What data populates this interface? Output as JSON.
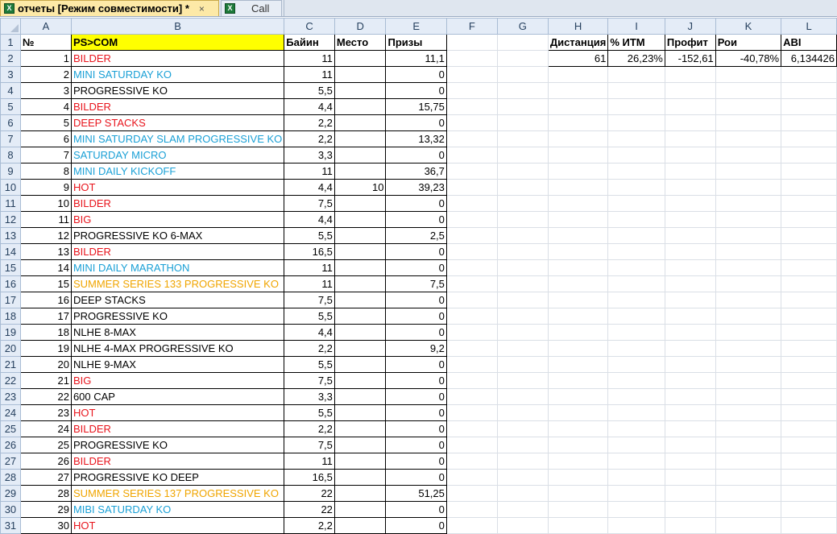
{
  "tabs": [
    {
      "title": "отчеты  [Режим совместимости] *",
      "close": "×",
      "active": true
    },
    {
      "title": "Call",
      "active": false
    }
  ],
  "columns": [
    "A",
    "B",
    "C",
    "D",
    "E",
    "F",
    "G",
    "H",
    "I",
    "J",
    "K",
    "L"
  ],
  "headers": {
    "A": "№",
    "B": "PS>COM",
    "C": "Байин",
    "D": "Место",
    "E": "Призы"
  },
  "stats": {
    "labels": [
      "Дистанция",
      "% ИТМ",
      "Профит",
      "Рои",
      "ABI"
    ],
    "values": [
      "61",
      "26,23%",
      "-152,61",
      "-40,78%",
      "6,134426"
    ]
  },
  "colors": {
    "red": "#e8141c",
    "blue": "#1aa0d6",
    "orange": "#f0a500",
    "black": "#000000",
    "highlight": "#ffff00"
  },
  "rows": [
    {
      "n": "1",
      "name": "BILDER",
      "color": "red",
      "buyin": "11",
      "place": "",
      "prize": "11,1"
    },
    {
      "n": "2",
      "name": "MINI SATURDAY KO",
      "color": "blue",
      "buyin": "11",
      "place": "",
      "prize": "0"
    },
    {
      "n": "3",
      "name": "PROGRESSIVE KO",
      "color": "black",
      "buyin": "5,5",
      "place": "",
      "prize": "0"
    },
    {
      "n": "4",
      "name": "BILDER",
      "color": "red",
      "buyin": "4,4",
      "place": "",
      "prize": "15,75"
    },
    {
      "n": "5",
      "name": "DEEP STACKS",
      "color": "red",
      "buyin": "2,2",
      "place": "",
      "prize": "0"
    },
    {
      "n": "6",
      "name": "MINI SATURDAY SLAM PROGRESSIVE  KO",
      "color": "blue",
      "buyin": "2,2",
      "place": "",
      "prize": "13,32"
    },
    {
      "n": "7",
      "name": "SATURDAY MICRO",
      "color": "blue",
      "buyin": "3,3",
      "place": "",
      "prize": "0"
    },
    {
      "n": "8",
      "name": "MINI DAILY KICKOFF",
      "color": "blue",
      "buyin": "11",
      "place": "",
      "prize": "36,7"
    },
    {
      "n": "9",
      "name": "HOT",
      "color": "red",
      "buyin": "4,4",
      "place": "10",
      "prize": "39,23"
    },
    {
      "n": "10",
      "name": "BILDER",
      "color": "red",
      "buyin": "7,5",
      "place": "",
      "prize": "0"
    },
    {
      "n": "11",
      "name": "BIG",
      "color": "red",
      "buyin": "4,4",
      "place": "",
      "prize": "0"
    },
    {
      "n": "12",
      "name": "PROGRESSIVE KO 6-MAX",
      "color": "black",
      "buyin": "5,5",
      "place": "",
      "prize": "2,5"
    },
    {
      "n": "13",
      "name": "BILDER",
      "color": "red",
      "buyin": "16,5",
      "place": "",
      "prize": "0"
    },
    {
      "n": "14",
      "name": "MINI DAILY MARATHON",
      "color": "blue",
      "buyin": "11",
      "place": "",
      "prize": "0"
    },
    {
      "n": "15",
      "name": "SUMMER SERIES 133 PROGRESSIVE KO",
      "color": "orange",
      "buyin": "11",
      "place": "",
      "prize": "7,5"
    },
    {
      "n": "16",
      "name": "DEEP STACKS",
      "color": "black",
      "buyin": "7,5",
      "place": "",
      "prize": "0"
    },
    {
      "n": "17",
      "name": "PROGRESSIVE KO",
      "color": "black",
      "buyin": "5,5",
      "place": "",
      "prize": "0"
    },
    {
      "n": "18",
      "name": "NLHE 8-MAX",
      "color": "black",
      "buyin": "4,4",
      "place": "",
      "prize": "0"
    },
    {
      "n": "19",
      "name": "NLHE 4-MAX PROGRESSIVE KO",
      "color": "black",
      "buyin": "2,2",
      "place": "",
      "prize": "9,2"
    },
    {
      "n": "20",
      "name": "NLHE 9-MAX",
      "color": "black",
      "buyin": "5,5",
      "place": "",
      "prize": "0"
    },
    {
      "n": "21",
      "name": "BIG",
      "color": "red",
      "buyin": "7,5",
      "place": "",
      "prize": "0"
    },
    {
      "n": "22",
      "name": "600 CAP",
      "color": "black",
      "buyin": "3,3",
      "place": "",
      "prize": "0"
    },
    {
      "n": "23",
      "name": "HOT",
      "color": "red",
      "buyin": "5,5",
      "place": "",
      "prize": "0"
    },
    {
      "n": "24",
      "name": "BILDER",
      "color": "red",
      "buyin": "2,2",
      "place": "",
      "prize": "0"
    },
    {
      "n": "25",
      "name": "PROGRESSIVE KO",
      "color": "black",
      "buyin": "7,5",
      "place": "",
      "prize": "0"
    },
    {
      "n": "26",
      "name": "BILDER",
      "color": "red",
      "buyin": "11",
      "place": "",
      "prize": "0"
    },
    {
      "n": "27",
      "name": "PROGRESSIVE KO DEEP",
      "color": "black",
      "buyin": "16,5",
      "place": "",
      "prize": "0"
    },
    {
      "n": "28",
      "name": "SUMMER SERIES 137 PROGRESSIVE KO",
      "color": "orange",
      "buyin": "22",
      "place": "",
      "prize": "51,25"
    },
    {
      "n": "29",
      "name": "MIBI SATURDAY KO",
      "color": "blue",
      "buyin": "22",
      "place": "",
      "prize": "0"
    },
    {
      "n": "30",
      "name": "HOT",
      "color": "red",
      "buyin": "2,2",
      "place": "",
      "prize": "0"
    }
  ]
}
